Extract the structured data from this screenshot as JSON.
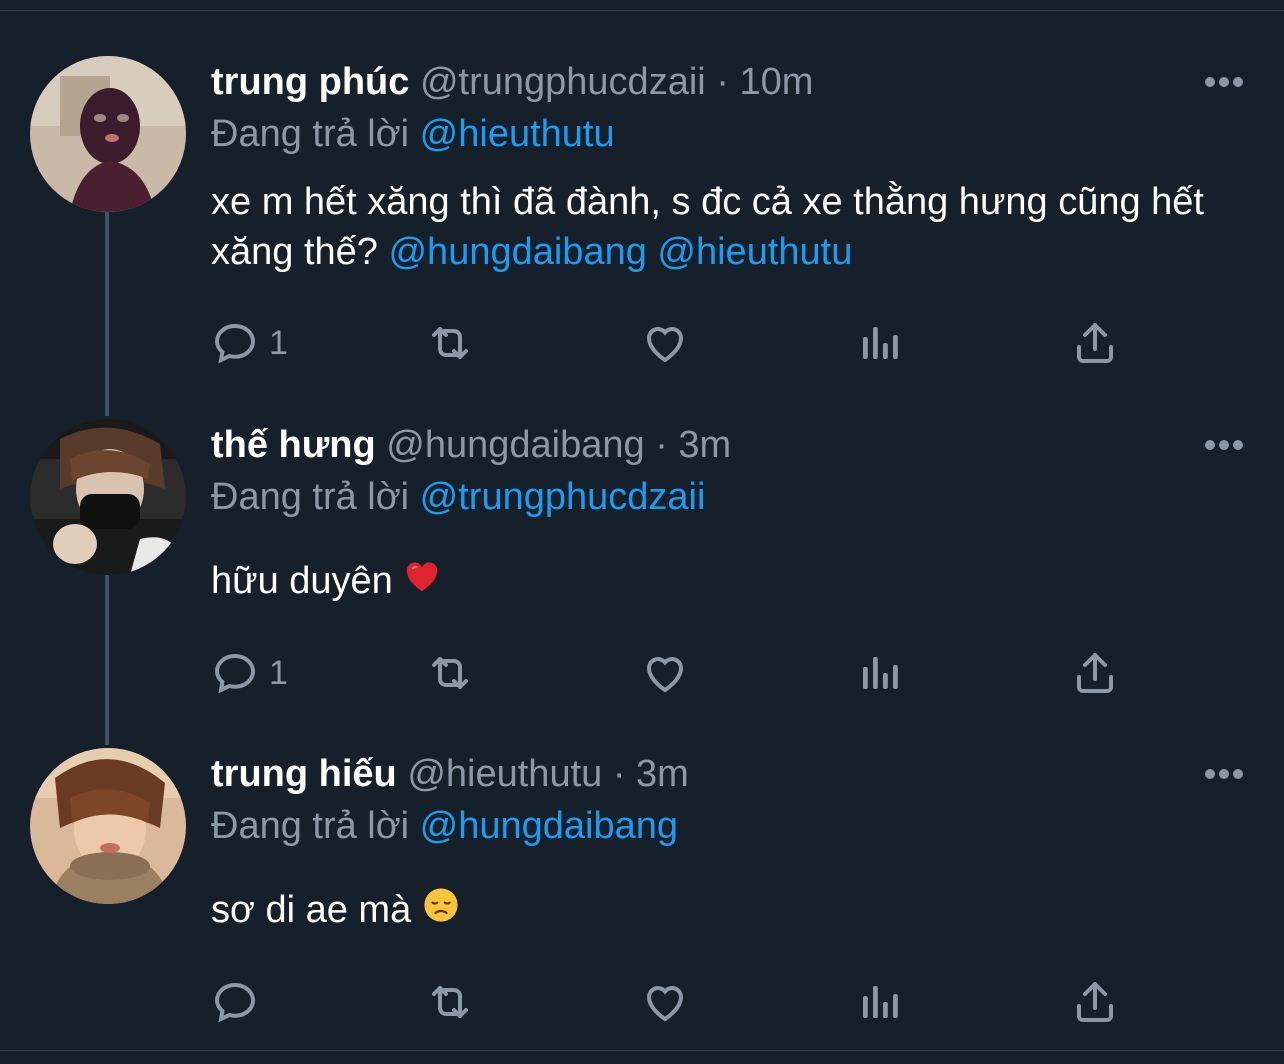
{
  "labels": {
    "replying_prefix": "Đang trả lời",
    "separator": "·"
  },
  "colors": {
    "background": "#15202b",
    "text_primary": "#ffffff",
    "text_secondary": "#8b98a5",
    "accent": "#1d9bf0",
    "thread_line": "#3d5466"
  },
  "tweets": [
    {
      "name": "trung phúc",
      "handle": "@trungphucdzaii",
      "time": "10m",
      "replying_to": "@hieuthutu",
      "text_plain": "xe m hết xăng thì đã đành, s đc cả xe thằng hưng cũng hết xăng thế?",
      "mention_1": "@hungdaibang",
      "mention_2": "@hieuthutu",
      "reply_count": "1",
      "icons": [
        "reply-icon",
        "retweet-icon",
        "like-icon",
        "analytics-icon",
        "share-icon",
        "more-icon"
      ]
    },
    {
      "name": "thế hưng",
      "handle": "@hungdaibang",
      "time": "3m",
      "replying_to": "@trungphucdzaii",
      "text_plain": "hữu duyên",
      "emoji": "red-heart-emoji",
      "reply_count": "1",
      "icons": [
        "reply-icon",
        "retweet-icon",
        "like-icon",
        "analytics-icon",
        "share-icon",
        "more-icon"
      ]
    },
    {
      "name": "trung hiếu",
      "handle": "@hieuthutu",
      "time": "3m",
      "replying_to": "@hungdaibang",
      "text_plain": "sơ di ae mà",
      "emoji": "disappointed-face-emoji",
      "reply_count": "",
      "icons": [
        "reply-icon",
        "retweet-icon",
        "like-icon",
        "analytics-icon",
        "share-icon",
        "more-icon"
      ]
    }
  ]
}
